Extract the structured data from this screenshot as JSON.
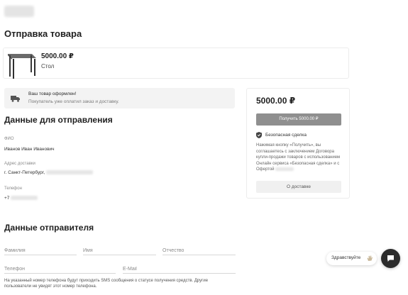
{
  "page": {
    "title": "Отправка товара"
  },
  "product": {
    "price": "5000.00 ₽",
    "name": "Стол"
  },
  "notice": {
    "title": "Ваш товар оформлен!",
    "subtitle": "Покупатель уже оплатил заказ и доставку."
  },
  "shipping": {
    "title": "Данные для отправления",
    "fio_label": "ФИО",
    "fio_value": "Иванов Иван Иванович",
    "address_label": "Адрес доставки",
    "address_value": "г. Санкт-Петербург,",
    "phone_label": "Телефон",
    "phone_value": "+7"
  },
  "sender": {
    "title": "Данные отправителя",
    "lastname_placeholder": "Фамилия",
    "firstname_placeholder": "Имя",
    "middlename_placeholder": "Отчество",
    "phone_placeholder": "Телефон",
    "email_placeholder": "E-Mail",
    "footnote": "На указанный номер телефона будут приходить SMS сообщения о статусе получения средств. Другие пользователи не увидят этот номер телефона."
  },
  "summary": {
    "price": "5000.00 ₽",
    "get_button": "Получить 5000.00 ₽",
    "safe_deal": "Безопасная сделка",
    "terms": "Нажимая кнопку «Получить», вы соглашаетесь с заключением Договора купли-продажи товаров с использованием Онлайн сервиса «Безопасная сделка» и с Офертой",
    "delivery_button": "О доставке"
  },
  "chat": {
    "greeting": "Здравствуйте"
  },
  "colors": {
    "primary_button": "#8f8f8f",
    "chat_button": "#2b2b2b",
    "accent_gray": "#f3f3f3"
  },
  "icons": [
    "truck-icon",
    "shield-check-icon",
    "wave-hand-icon",
    "chat-icon",
    "table-image"
  ]
}
